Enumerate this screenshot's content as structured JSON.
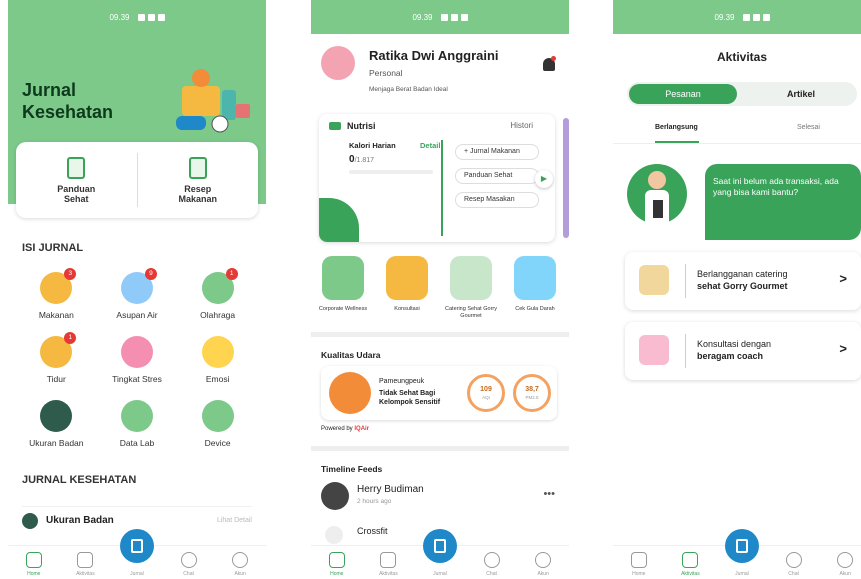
{
  "status": {
    "time": "09.39"
  },
  "p1": {
    "title_line1": "Jurnal",
    "title_line2": "Kesehatan",
    "card": [
      {
        "line1": "Panduan",
        "line2": "Sehat"
      },
      {
        "line1": "Resep",
        "line2": "Makanan"
      }
    ],
    "section_isi": "ISI JURNAL",
    "items": [
      {
        "label": "Makanan",
        "badge": "3"
      },
      {
        "label": "Asupan Air",
        "badge": "9"
      },
      {
        "label": "Olahraga",
        "badge": "1"
      },
      {
        "label": "Tidur",
        "badge": "1"
      },
      {
        "label": "Tingkat Stres",
        "badge": ""
      },
      {
        "label": "Emosi",
        "badge": ""
      },
      {
        "label": "Ukuran Badan",
        "badge": ""
      },
      {
        "label": "Data Lab",
        "badge": ""
      },
      {
        "label": "Device",
        "badge": ""
      }
    ],
    "section_jurnal": "JURNAL KESEHATAN",
    "ukuran": "Ukuran Badan",
    "lihat": "Lihat Detail"
  },
  "p2": {
    "name": "Ratika Dwi Anggraini",
    "role": "Personal",
    "goal": "Menjaga Berat Badan Ideal",
    "nutrisi": "Nutrisi",
    "histori": "Histori",
    "kalori_label": "Kalori Harian",
    "detail": "Detail",
    "kalori_val": "0",
    "kalori_max": "/1.817",
    "pills": [
      "+ Jurnal Makanan",
      "Panduan Sehat",
      "Resep Masakan"
    ],
    "services": [
      "Corporate Wellness",
      "Konsultasi",
      "Catering Sehat Gorry Gourmet",
      "Cek Gula Darah"
    ],
    "kualitas": "Kualitas Udara",
    "lokasi": "Pameungpeuk",
    "status_udara": "Tidak Sehat Bagi Kelompok Sensitif",
    "aqi_val": "109",
    "aqi_lbl": "AQI",
    "pm_val": "38,7",
    "pm_lbl": "PM2.5",
    "powered": "Powered by",
    "powered_brand": "IQAir",
    "timeline": "Timeline Feeds",
    "feed_name": "Herry Budiman",
    "feed_time": "2 hours ago",
    "feed2": "Crossfit"
  },
  "p3": {
    "title": "Aktivitas",
    "seg_on": "Pesanan",
    "seg_off": "Artikel",
    "tab_on": "Berlangsung",
    "tab_off": "Selesai",
    "bubble": "Saat ini belum ada transaksi, ada yang bisa kami bantu?",
    "card1_a": "Berlangganan catering",
    "card1_b": "sehat Gorry Gourmet",
    "card2_a": "Konsultasi dengan",
    "card2_b": "beragam coach"
  },
  "nav": [
    "Home",
    "Aktivitas",
    "Jurnal",
    "Chat",
    "Akun"
  ],
  "colors": {
    "primary": "#3aa35a",
    "header": "#7cc98a",
    "fab": "#1e88c9",
    "badge": "#e53935"
  }
}
